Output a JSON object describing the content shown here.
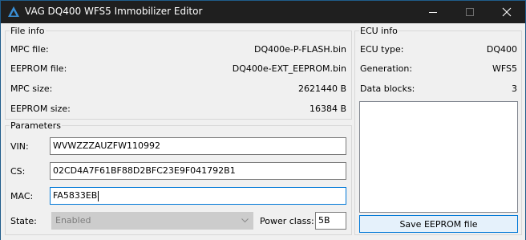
{
  "window": {
    "title": "VAG DQ400 WFS5 Immobilizer Editor",
    "icons": {
      "app": "triangle-logo-icon",
      "minimize": "minimize-icon",
      "maximize": "maximize-icon",
      "close": "close-icon"
    }
  },
  "file_info": {
    "legend": "File info",
    "rows": [
      {
        "label": "MPC file:",
        "value": "DQ400e-P-FLASH.bin"
      },
      {
        "label": "EEPROM file:",
        "value": "DQ400e-EXT_EEPROM.bin"
      },
      {
        "label": "MPC size:",
        "value": "2621440 B"
      },
      {
        "label": "EEPROM size:",
        "value": "16384 B"
      }
    ]
  },
  "parameters": {
    "legend": "Parameters",
    "vin": {
      "label": "VIN:",
      "value": "WVWZZZAUZFW110992"
    },
    "cs": {
      "label": "CS:",
      "value": "02CD4A7F61BF88D2BFC23E9F041792B1"
    },
    "mac": {
      "label": "MAC:",
      "value": "FA5833EB"
    },
    "state": {
      "label": "State:",
      "selected": "Enabled"
    },
    "power_class": {
      "label": "Power class:",
      "value": "5B"
    }
  },
  "ecu_info": {
    "legend": "ECU info",
    "rows": [
      {
        "label": "ECU type:",
        "value": "DQ400"
      },
      {
        "label": "Generation:",
        "value": "WFS5"
      },
      {
        "label": "Data blocks:",
        "value": "3"
      }
    ]
  },
  "actions": {
    "save_eeprom": "Save EEPROM file"
  },
  "colors": {
    "titlebar": "#1f1f1f",
    "accent": "#0078d7",
    "window_bg": "#f0f0f0",
    "button_bg": "#e5f1fb"
  }
}
